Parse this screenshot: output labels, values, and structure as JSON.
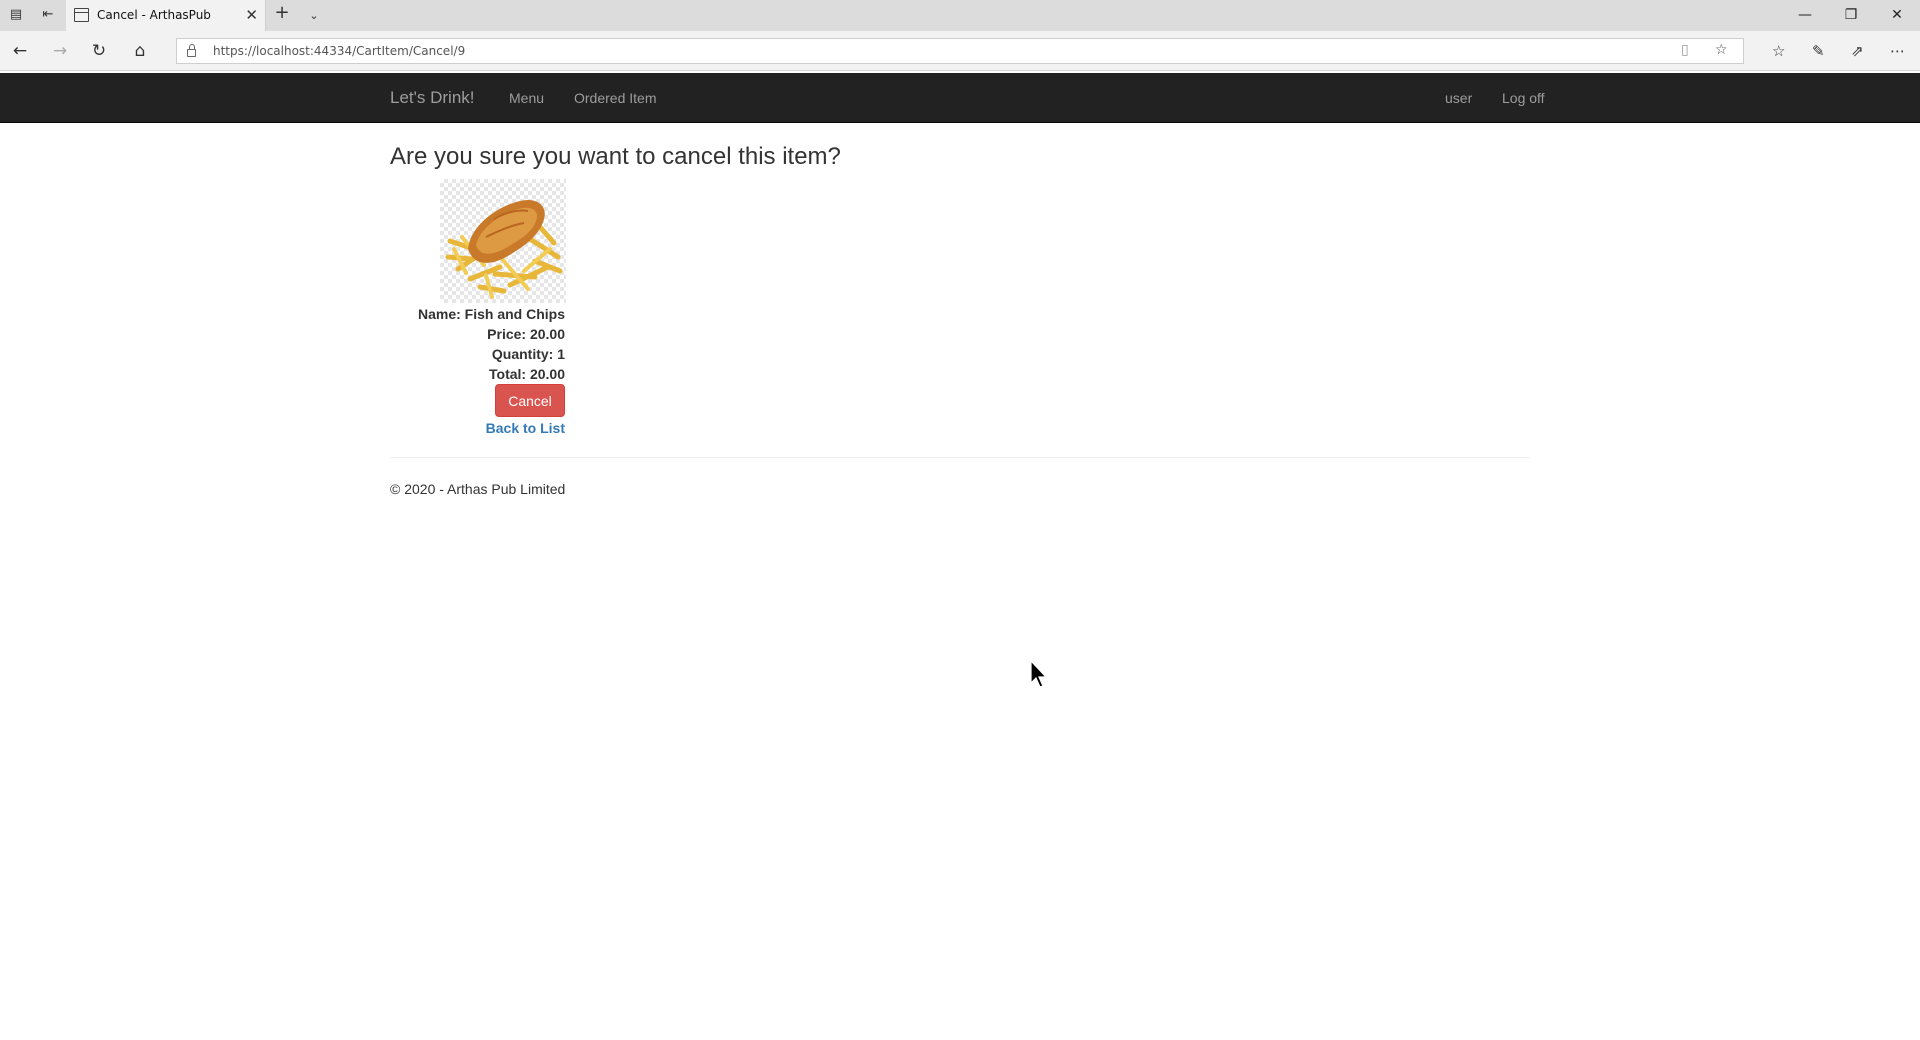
{
  "browser": {
    "tab_title": "Cancel - ArthasPub",
    "url": "https://localhost:44334/CartItem/Cancel/9"
  },
  "navbar": {
    "brand": "Let's Drink!",
    "links": [
      "Menu",
      "Ordered Item"
    ],
    "user": "user",
    "logoff": "Log off"
  },
  "page": {
    "heading": "Are you sure you want to cancel this item?",
    "item": {
      "name": "Name: Fish and Chips",
      "price": "Price: 20.00",
      "quantity": "Quantity: 1",
      "total": "Total: 20.00"
    },
    "cancel_label": "Cancel",
    "back_label": "Back to List",
    "footer": "© 2020 - Arthas Pub Limited"
  },
  "colors": {
    "navbar_bg": "#222222",
    "danger": "#d9534f",
    "link": "#337ab7"
  }
}
